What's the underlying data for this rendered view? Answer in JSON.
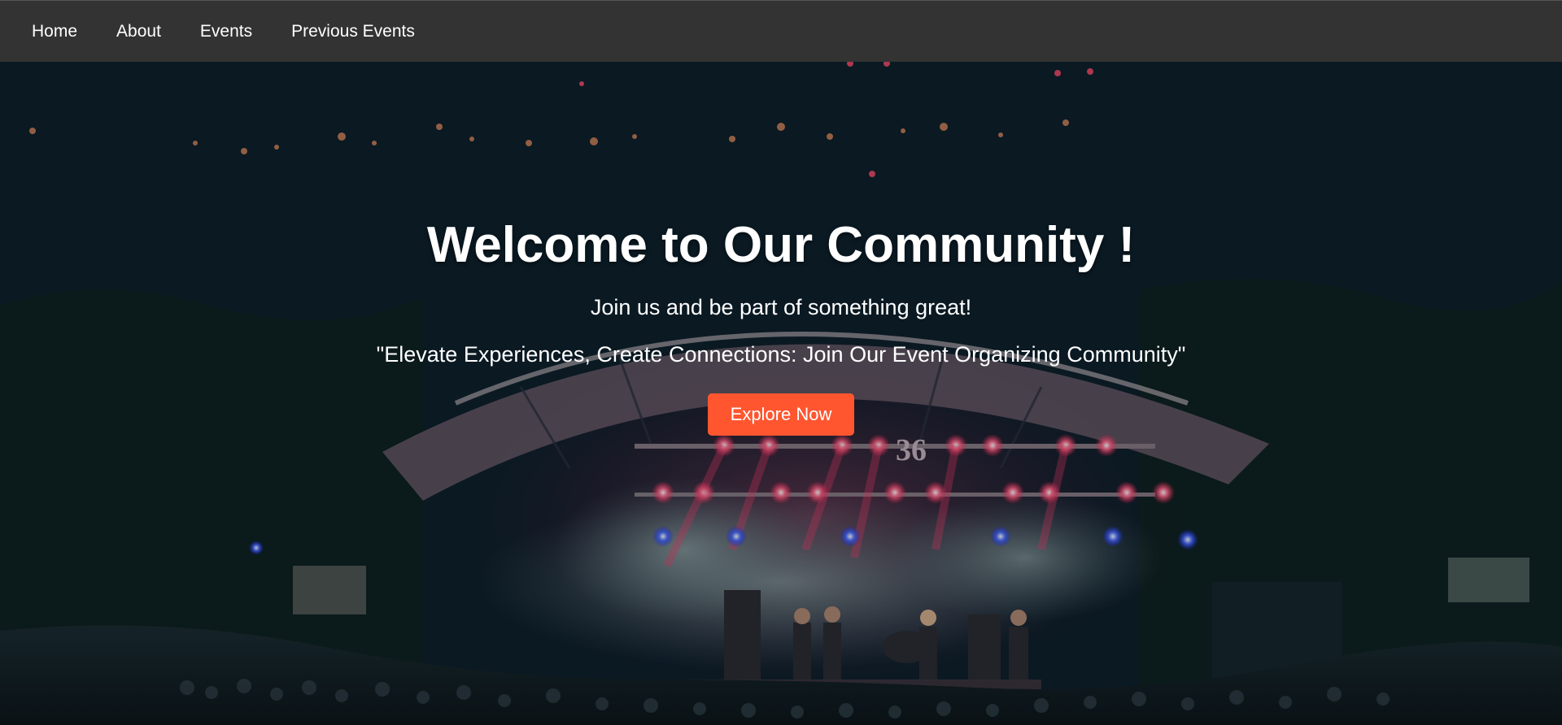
{
  "nav": {
    "items": [
      {
        "label": "Home"
      },
      {
        "label": "About"
      },
      {
        "label": "Events"
      },
      {
        "label": "Previous Events"
      }
    ]
  },
  "hero": {
    "title": "Welcome to Our Community !",
    "subtitle": "Join us and be part of something great!",
    "quote": "\"Elevate Experiences, Create Connections: Join Our Event Organizing Community\"",
    "cta_label": "Explore Now",
    "stage_sign": "36"
  },
  "colors": {
    "navbar_bg": "#333333",
    "cta_bg": "#ff5630",
    "text": "#ffffff"
  }
}
